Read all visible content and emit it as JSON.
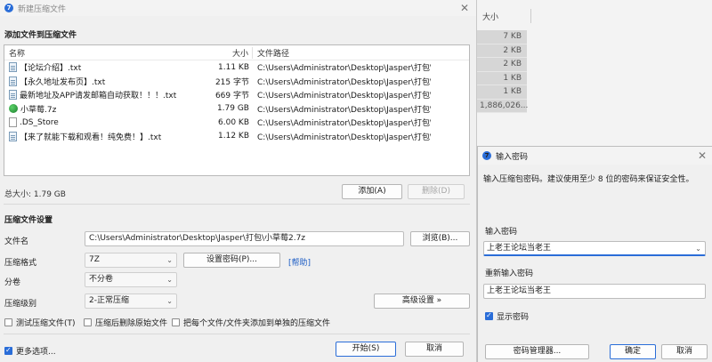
{
  "background": {
    "col_header": "大小",
    "sizes": [
      "7 KB",
      "2 KB",
      "2 KB",
      "1 KB",
      "1 KB",
      "1,886,026..."
    ]
  },
  "main": {
    "title": "新建压缩文件",
    "add_section": "添加文件到压缩文件",
    "columns": {
      "name": "名称",
      "size": "大小",
      "path": "文件路径"
    },
    "files": [
      {
        "name": "【论坛介绍】.txt",
        "size": "1.11 KB",
        "path": "C:\\Users\\Administrator\\Desktop\\Jasper\\打包\\...",
        "icon": "text-file-icon"
      },
      {
        "name": "【永久地址发布页】.txt",
        "size": "215 字节",
        "path": "C:\\Users\\Administrator\\Desktop\\Jasper\\打包\\...",
        "icon": "text-file-icon"
      },
      {
        "name": "最新地址及APP请发邮箱自动获取！！！.txt",
        "size": "669 字节",
        "path": "C:\\Users\\Administrator\\Desktop\\Jasper\\打包\\...",
        "icon": "text-file-icon"
      },
      {
        "name": "小草莓.7z",
        "size": "1.79 GB",
        "path": "C:\\Users\\Administrator\\Desktop\\Jasper\\打包\\...",
        "icon": "archive-icon"
      },
      {
        "name": ".DS_Store",
        "size": "6.00 KB",
        "path": "C:\\Users\\Administrator\\Desktop\\Jasper\\打包\\...",
        "icon": "blank-file-icon"
      },
      {
        "name": "【来了就能下载和观看！纯免费！】.txt",
        "size": "1.12 KB",
        "path": "C:\\Users\\Administrator\\Desktop\\Jasper\\打包\\...",
        "icon": "text-file-icon"
      }
    ],
    "total": "总大小: 1.79 GB",
    "add_button": "添加(A)",
    "delete_button": "删除(D)",
    "settings_section": "压缩文件设置",
    "filename_label": "文件名",
    "filename_value": "C:\\Users\\Administrator\\Desktop\\Jasper\\打包\\小草莓2.7z",
    "browse_button": "浏览(B)...",
    "format_label": "压缩格式",
    "format_value": "7Z",
    "set_password_button": "设置密码(P)...",
    "help_link": "[帮助]",
    "volume_label": "分卷",
    "volume_value": "不分卷",
    "level_label": "压缩级别",
    "level_value": "2-正常压缩",
    "advanced_button": "高级设置 »",
    "test_check": "测试压缩文件(T)",
    "delete_after_check": "压缩后删除原始文件",
    "separate_check": "把每个文件/文件夹添加到单独的压缩文件",
    "more_options": "更多选项...",
    "start_button": "开始(S)",
    "cancel_button": "取消"
  },
  "password_dialog": {
    "title": "输入密码",
    "description": "输入压缩包密码。建议使用至少 8 位的密码来保证安全性。",
    "enter_label": "输入密码",
    "enter_value": "上老王论坛当老王",
    "confirm_label": "重新输入密码",
    "confirm_value": "上老王论坛当老王",
    "show_password": "显示密码",
    "manager_button": "密码管理器...",
    "ok_button": "确定",
    "cancel_button": "取消"
  }
}
